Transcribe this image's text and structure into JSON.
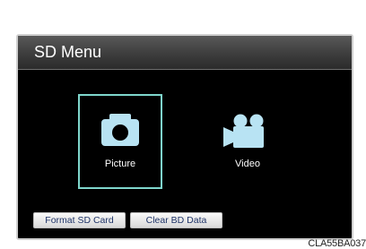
{
  "header": {
    "title": "SD Menu"
  },
  "tiles": [
    {
      "label": "Picture",
      "icon": "camera-icon",
      "selected": true
    },
    {
      "label": "Video",
      "icon": "video-camera-icon",
      "selected": false
    }
  ],
  "buttons": {
    "format_label": "Format SD Card",
    "clear_label": "Clear BD Data"
  },
  "figure_code": "CLA55BA037",
  "colors": {
    "selection_border": "#7fd6cc",
    "icon": "#b8e3f3",
    "button_text": "#1f3468",
    "screen_background": "#000000"
  }
}
